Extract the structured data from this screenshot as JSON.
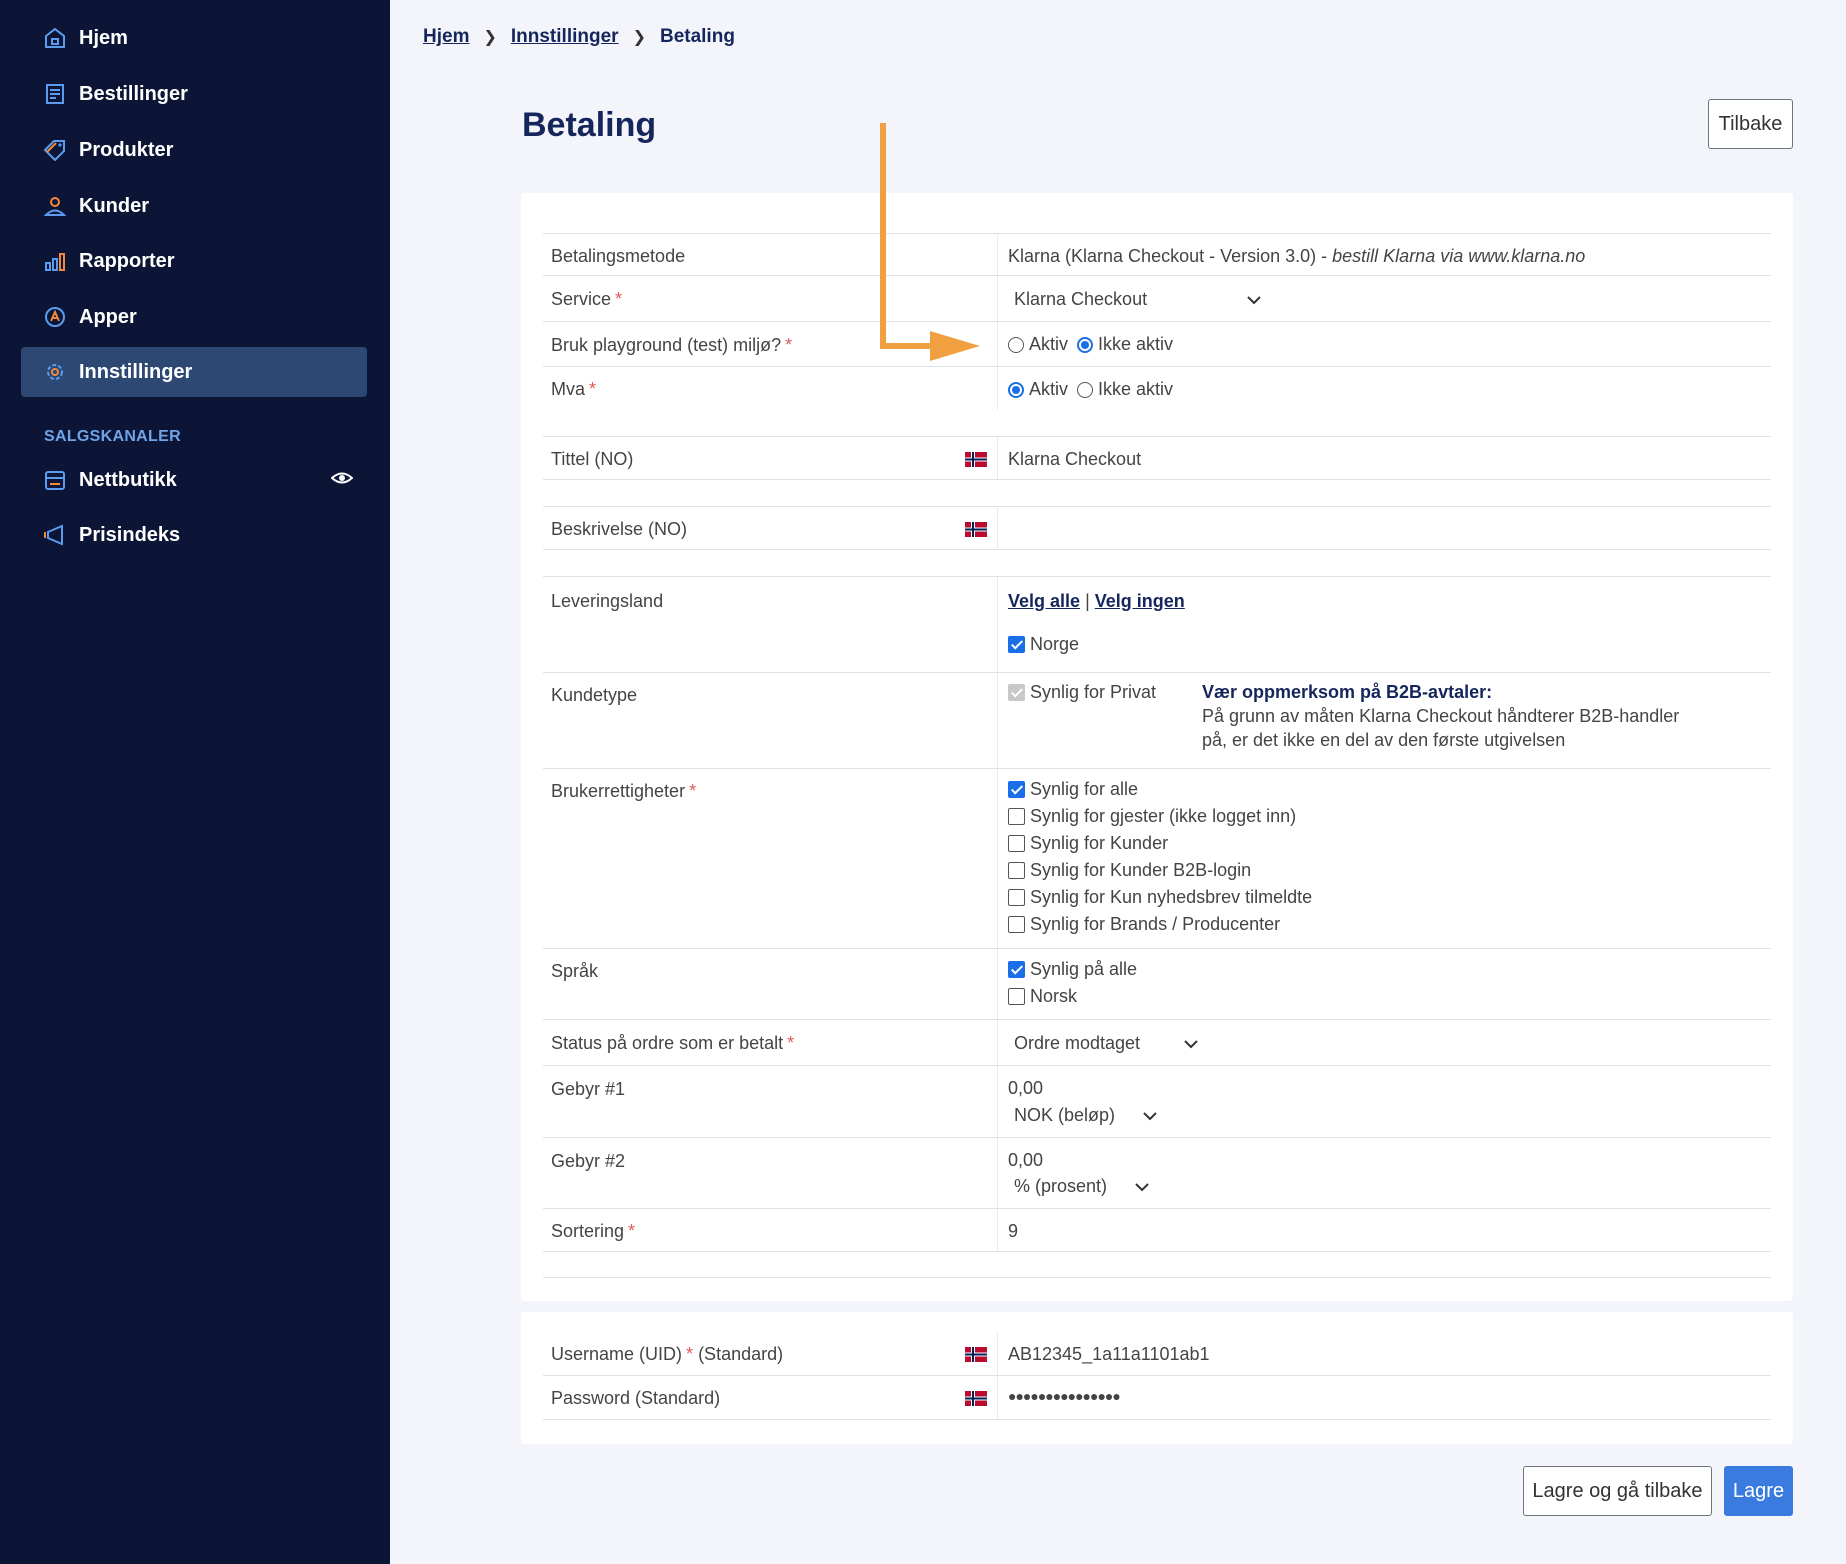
{
  "sidebar": {
    "items": [
      {
        "label": "Hjem",
        "icon": "home-icon"
      },
      {
        "label": "Bestillinger",
        "icon": "orders-icon"
      },
      {
        "label": "Produkter",
        "icon": "tag-icon"
      },
      {
        "label": "Kunder",
        "icon": "user-icon"
      },
      {
        "label": "Rapporter",
        "icon": "bar-chart-icon"
      },
      {
        "label": "Apper",
        "icon": "apps-icon"
      },
      {
        "label": "Innstillinger",
        "icon": "gear-icon",
        "active": true
      }
    ],
    "section_label": "SALGSKANALER",
    "channels": [
      {
        "label": "Nettbutikk",
        "icon": "store-icon"
      },
      {
        "label": "Prisindeks",
        "icon": "megaphone-icon"
      }
    ]
  },
  "breadcrumb": {
    "home": "Hjem",
    "settings": "Innstillinger",
    "current": "Betaling"
  },
  "page": {
    "title": "Betaling",
    "back_button": "Tilbake"
  },
  "form": {
    "payment_method": {
      "label": "Betalingsmetode",
      "value": "Klarna (Klarna Checkout - Version 3.0) - ",
      "link_text": "bestill Klarna via www.klarna.no"
    },
    "service": {
      "label": "Service",
      "value": "Klarna Checkout"
    },
    "playground": {
      "label": "Bruk playground (test) miljø?",
      "opt_on": "Aktiv",
      "opt_off": "Ikke aktiv"
    },
    "vat": {
      "label": "Mva",
      "opt_on": "Aktiv",
      "opt_off": "Ikke aktiv"
    },
    "title_no": {
      "label": "Tittel (NO)",
      "value": "Klarna Checkout"
    },
    "description_no": {
      "label": "Beskrivelse (NO)",
      "value": ""
    },
    "delivery_country": {
      "label": "Leveringsland",
      "select_all": "Velg alle",
      "separator": "|",
      "select_none": "Velg ingen",
      "country": "Norge"
    },
    "customer_type": {
      "label": "Kundetype",
      "option": "Synlig for Privat",
      "note_title": "Vær oppmerksom på B2B-avtaler:",
      "note_line1": "På grunn av måten Klarna Checkout håndterer B2B-handler",
      "note_line2": "på, er det ikke en del av den første utgivelsen"
    },
    "user_rights": {
      "label": "Brukerrettigheter",
      "options": [
        "Synlig for alle",
        "Synlig for gjester (ikke logget inn)",
        "Synlig for Kunder",
        "Synlig for Kunder B2B-login",
        "Synlig for Kun nyhedsbrev tilmeldte",
        "Synlig for Brands / Producenter"
      ]
    },
    "language": {
      "label": "Språk",
      "options": [
        "Synlig på alle",
        "Norsk"
      ]
    },
    "order_status": {
      "label": "Status på ordre som er betalt",
      "value": "Ordre modtaget"
    },
    "fee1": {
      "label": "Gebyr #1",
      "value": "0,00",
      "unit": "NOK (beløp)"
    },
    "fee2": {
      "label": "Gebyr #2",
      "value": "0,00",
      "unit": "% (prosent)"
    },
    "sorting": {
      "label": "Sortering",
      "value": "9"
    },
    "required_mark": "*"
  },
  "credentials": {
    "username": {
      "label": "Username (UID)",
      "suffix": "(Standard)",
      "value": "AB12345_1a11a1101ab1"
    },
    "password": {
      "label": "Password (Standard)",
      "value": "●●●●●●●●●●●●●●●"
    }
  },
  "actions": {
    "save_back": "Lagre og gå tilbake",
    "save": "Lagre"
  },
  "colors": {
    "sidebar_bg": "#0c1535",
    "active_bg": "#2c4873",
    "primary": "#3a7be0",
    "accent_arrow": "#f0a040",
    "navy_text": "#15265c"
  }
}
